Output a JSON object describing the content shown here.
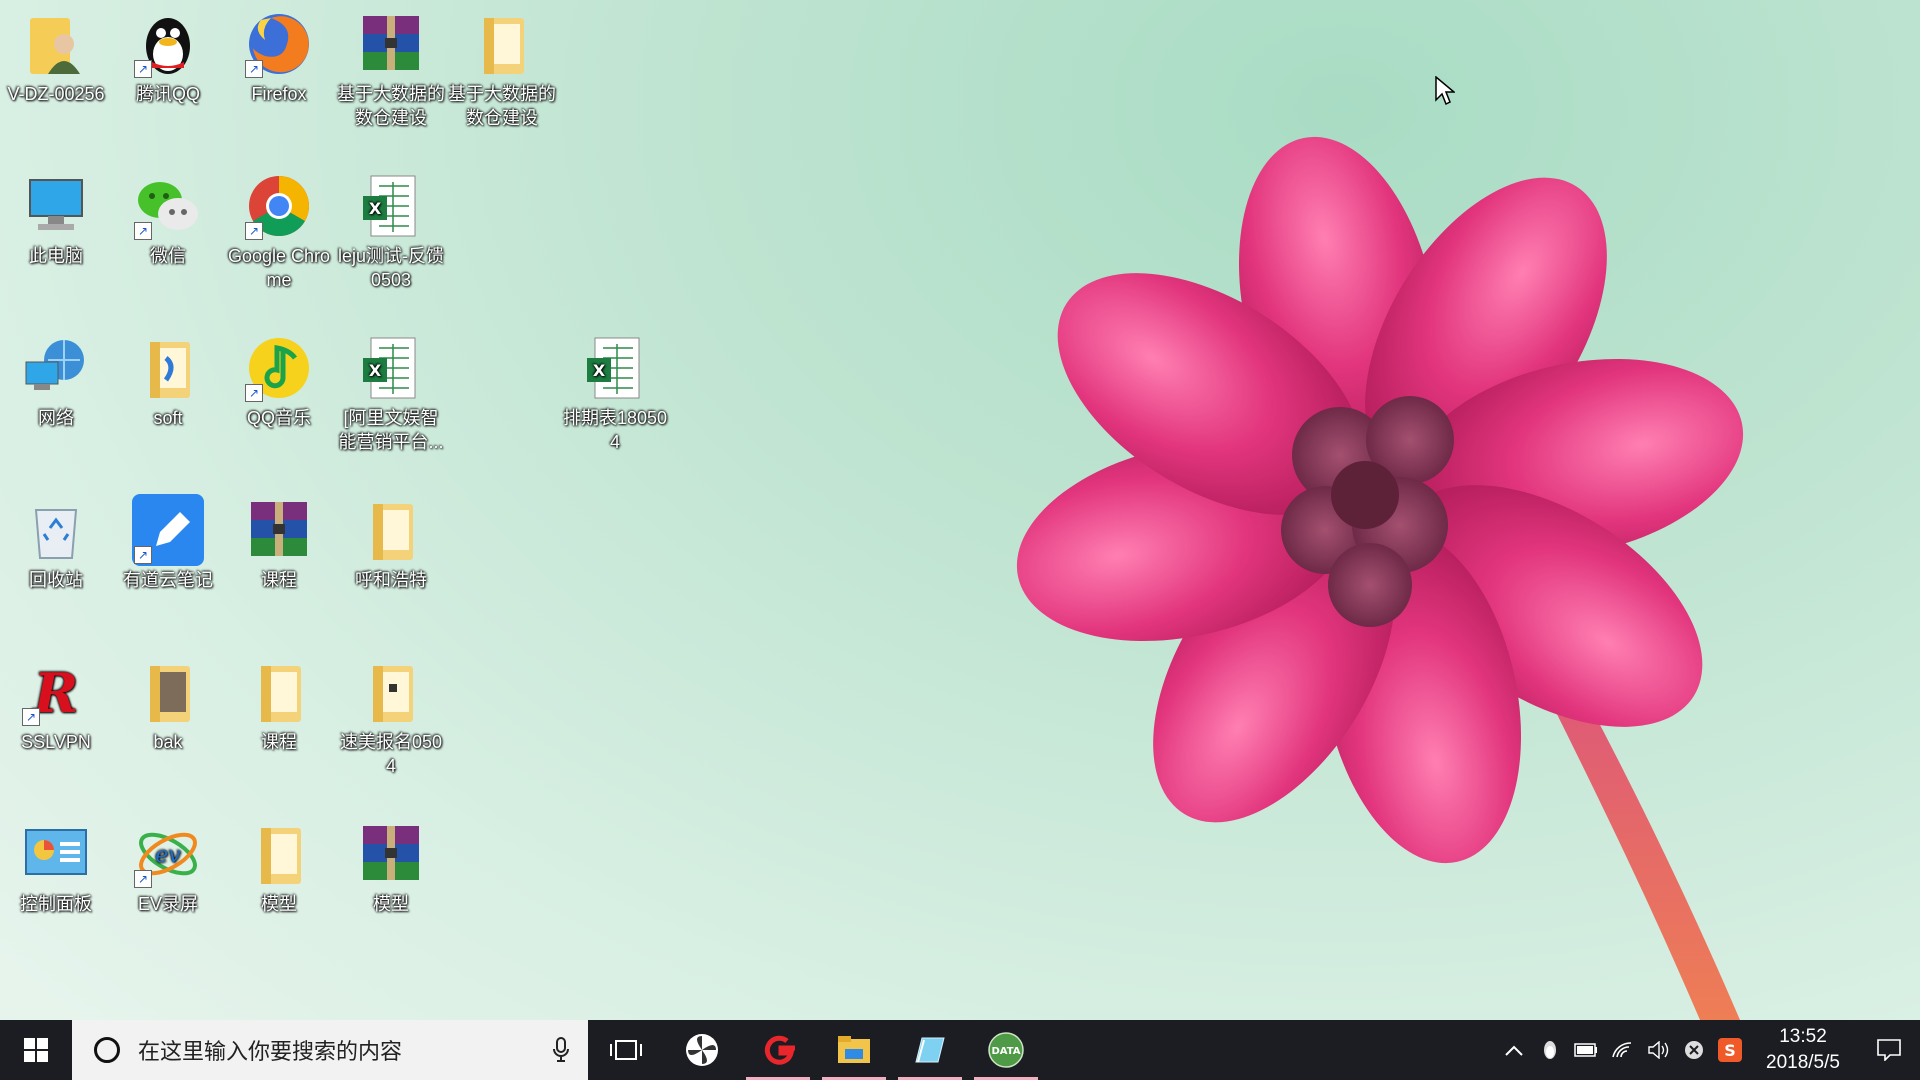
{
  "desktop": {
    "icons": [
      {
        "label": "V-DZ-00256",
        "icon": "user-folder-icon"
      },
      {
        "label": "腾讯QQ",
        "icon": "qq-icon"
      },
      {
        "label": "Firefox",
        "icon": "firefox-icon"
      },
      {
        "label": "基于大数据的数仓建设",
        "icon": "winrar-archive-icon"
      },
      {
        "label": "基于大数据的数仓建设",
        "icon": "folder-icon"
      },
      {
        "label": "此电脑",
        "icon": "this-pc-icon"
      },
      {
        "label": "微信",
        "icon": "wechat-icon"
      },
      {
        "label": "Google Chrome",
        "icon": "chrome-icon"
      },
      {
        "label": "leju测试-反馈0503",
        "icon": "excel-file-icon"
      },
      {
        "label": "网络",
        "icon": "network-icon"
      },
      {
        "label": "soft",
        "icon": "folder-icon"
      },
      {
        "label": "QQ音乐",
        "icon": "qq-music-icon"
      },
      {
        "label": "[阿里文娱智能营销平台...",
        "icon": "excel-file-icon"
      },
      {
        "label": "排期表180504",
        "icon": "excel-file-icon"
      },
      {
        "label": "回收站",
        "icon": "recycle-bin-icon"
      },
      {
        "label": "有道云笔记",
        "icon": "youdao-note-icon"
      },
      {
        "label": "课程",
        "icon": "winrar-archive-icon"
      },
      {
        "label": "呼和浩特",
        "icon": "folder-icon"
      },
      {
        "label": "SSLVPN",
        "icon": "sslvpn-icon"
      },
      {
        "label": "bak",
        "icon": "folder-icon"
      },
      {
        "label": "课程",
        "icon": "folder-icon"
      },
      {
        "label": "速美报名0504",
        "icon": "folder-icon"
      },
      {
        "label": "控制面板",
        "icon": "control-panel-icon"
      },
      {
        "label": "EV录屏",
        "icon": "ev-recorder-icon"
      },
      {
        "label": "模型",
        "icon": "folder-icon"
      },
      {
        "label": "模型",
        "icon": "winrar-archive-icon"
      }
    ]
  },
  "taskbar": {
    "search_placeholder": "在这里输入你要搜索的内容",
    "apps": [
      "task-view-icon",
      "pinwheel-app-icon",
      "red-g-app-icon",
      "file-explorer-icon",
      "blue-crystal-app-icon",
      "data-app-icon"
    ],
    "data_app_label": "DATA",
    "time": "13:52",
    "date": "2018/5/5",
    "sogou_label": "S"
  }
}
